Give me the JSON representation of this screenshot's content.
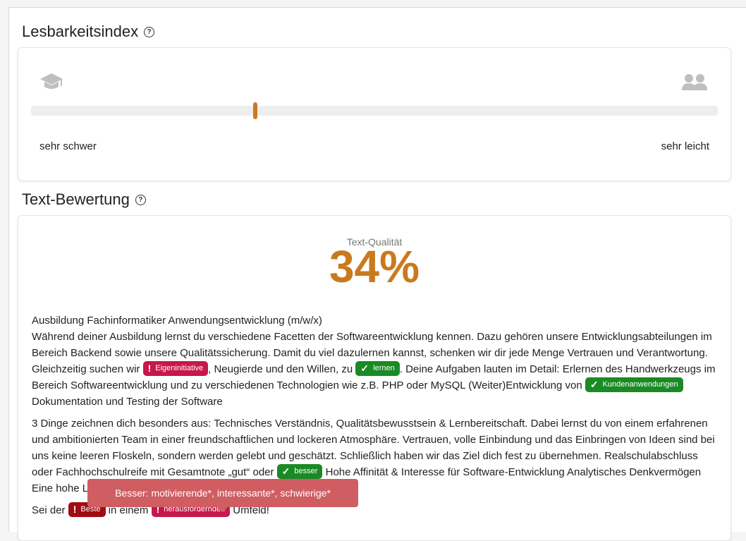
{
  "readability": {
    "title": "Lesbarkeitsindex",
    "help_icon": "?",
    "left_icon": "graduation-cap-icon",
    "right_icon": "people-icon",
    "slider_value": 0.327,
    "label_left": "sehr schwer",
    "label_right": "sehr leicht"
  },
  "evaluation": {
    "title": "Text-Bewertung",
    "help_icon": "?",
    "quality_label": "Text-Qualität",
    "quality_value": "34%"
  },
  "text": {
    "heading": "Ausbildung Fachinformatiker Anwendungsentwicklung (m/w/x)",
    "p1_a": "Während deiner Ausbildung lernst du verschiedene Facetten der Softwareentwicklung kennen. Dazu gehören unsere Entwicklungsabteilungen im Bereich Backend sowie unsere Qualitätssicherung. Damit du viel dazulernen kannst, schenken wir dir jede Menge Vertrauen und Verantwortung. Gleichzeitig suchen wir ",
    "badge_1": "Eigeninitiative",
    "p1_b": ", Neugierde und den Willen, zu ",
    "badge_2": "lernen",
    "p1_c": ". Deine Aufgaben lauten im Detail: Erlernen des Handwerkzeugs im Bereich Softwareentwicklung und zu verschiedenen Technologien wie z.B. PHP oder MySQL (Weiter)Entwicklung von ",
    "badge_3": "Kundenanwendungen",
    "p1_d": " Dokumentation und Testing der Software",
    "p2_a": "3 Dinge zeichnen dich besonders aus: Technisches Verständnis, Qualitätsbewusstsein & Lernbereitschaft. Dabei lernst du von einem erfahrenen und ambitionierten Team in einer freundschaftlichen und lockeren Atmosphäre. Vertrauen, volle Einbindung und das Einbringen von Ideen sind bei uns keine leeren Floskeln, sondern werden gelebt und geschätzt. Schließlich haben wir das Ziel dich fest zu übernehmen. Realschulabschluss oder Fachhochschulreife mit Gesamtnote „gut“ oder ",
    "badge_4": "besser",
    "p2_b": " Hohe Affinität & Interesse für Software-Entwicklung Analytisches Denkvermögen Eine hohe Lernbereitschaft, Ausdauer und Geduld",
    "p3_a": "Sei der ",
    "badge_5": "Beste",
    "p3_b": " in einem ",
    "badge_6": "herausfordernden",
    "p3_c": " Umfeld!",
    "mark_bad": "!",
    "mark_good": "✓"
  },
  "tooltip": {
    "text": "Besser: motivierende*, interessante*, schwierige*"
  },
  "colors": {
    "accent": "#c97a1e",
    "badge_bad": "#c8174a",
    "badge_dark": "#9f0d13",
    "badge_good": "#1a8a25",
    "tooltip": "#cf5d62"
  }
}
